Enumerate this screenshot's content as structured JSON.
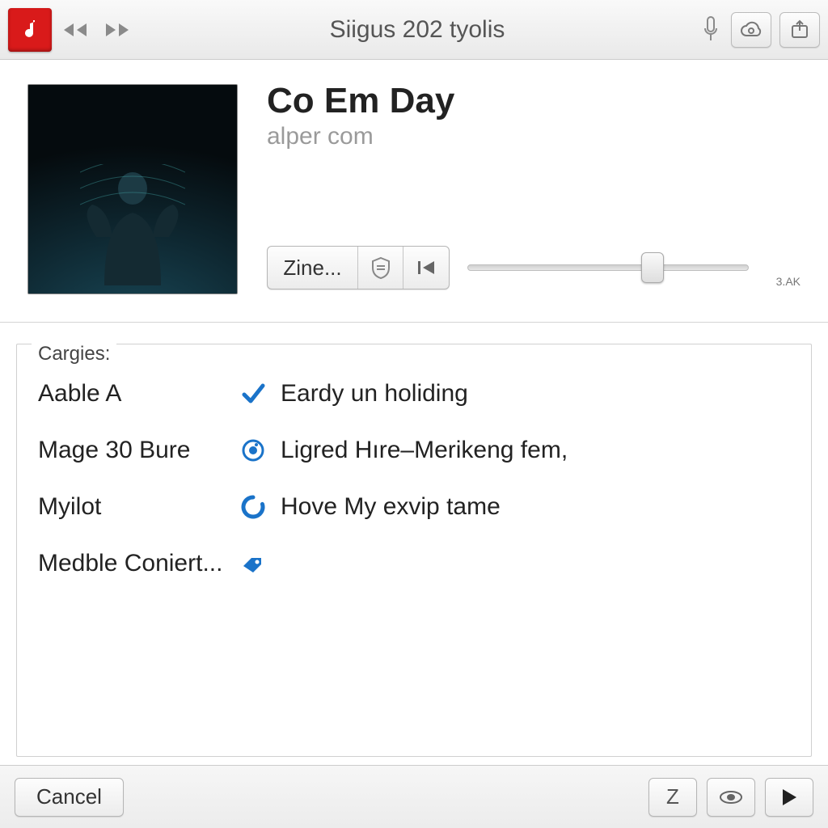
{
  "toolbar": {
    "title": "Siigus 202 tyolis"
  },
  "nowplaying": {
    "title": "Co Em Day",
    "subtitle": "alper com",
    "zine_label": "Zine...",
    "slider_value": 66,
    "slider_end_label": "3.AK"
  },
  "categories": {
    "legend": "Cargies:",
    "rows": [
      {
        "left": "Aable A",
        "icon": "check",
        "right": "Eardy un holiding"
      },
      {
        "left": "Mage 30 Bure",
        "icon": "radio",
        "right": "Ligred Hıre–Merikeng fem,"
      },
      {
        "left": "Myilot",
        "icon": "circle",
        "right": "Hove My exvip tame"
      },
      {
        "left": "Medble Coniert...",
        "icon": "tag",
        "right": ""
      }
    ]
  },
  "bottombar": {
    "cancel_label": "Cancel",
    "z_label": "Z"
  },
  "colors": {
    "accent_red": "#d91a1a",
    "link_blue": "#1a73c9"
  }
}
